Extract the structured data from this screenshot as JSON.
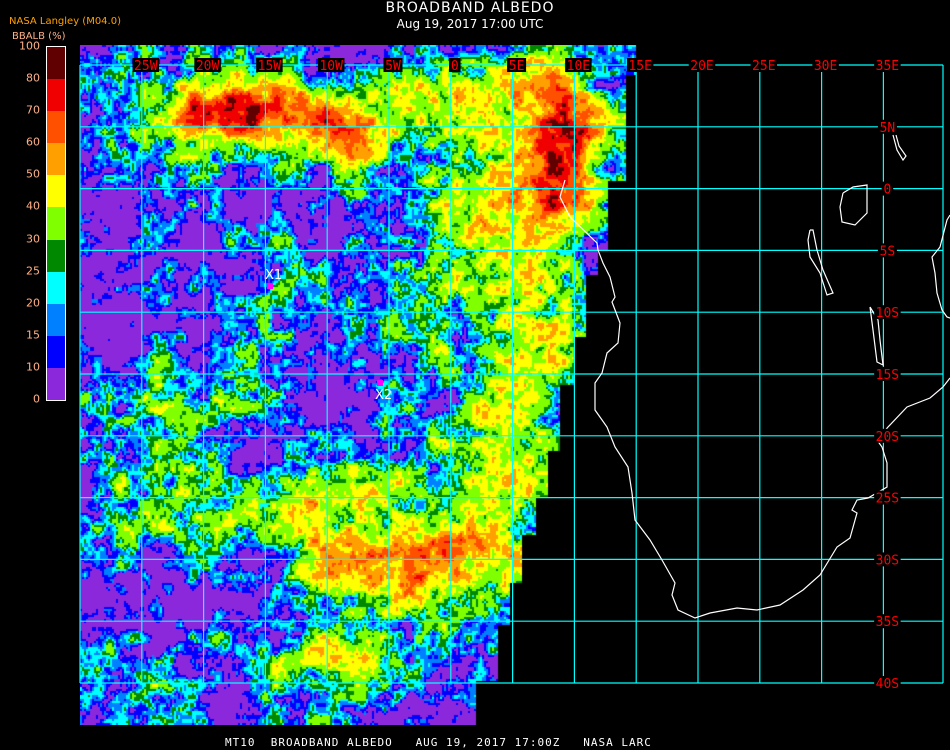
{
  "header": {
    "title": "BROADBAND ALBEDO",
    "subtitle": "Aug 19, 2017 17:00 UTC",
    "source": "NASA Langley (M04.0)",
    "units_label": "BBALB (%)"
  },
  "colorbar": {
    "ticks": [
      "0",
      "10",
      "15",
      "20",
      "25",
      "30",
      "40",
      "50",
      "60",
      "70",
      "80",
      "100"
    ],
    "bins": [
      {
        "min": 0,
        "max": 10,
        "color": "#8c28dc"
      },
      {
        "min": 10,
        "max": 15,
        "color": "#0000ff"
      },
      {
        "min": 15,
        "max": 20,
        "color": "#0080ff"
      },
      {
        "min": 20,
        "max": 25,
        "color": "#00ffff"
      },
      {
        "min": 25,
        "max": 30,
        "color": "#008800"
      },
      {
        "min": 30,
        "max": 40,
        "color": "#80ff00"
      },
      {
        "min": 40,
        "max": 50,
        "color": "#ffff00"
      },
      {
        "min": 50,
        "max": 60,
        "color": "#ffa000"
      },
      {
        "min": 60,
        "max": 70,
        "color": "#ff5000"
      },
      {
        "min": 70,
        "max": 80,
        "color": "#f00000"
      },
      {
        "min": 80,
        "max": 100,
        "color": "#600000"
      }
    ]
  },
  "map": {
    "lon_labels": [
      "25W",
      "20W",
      "15W",
      "10W",
      "5W",
      "0",
      "5E",
      "10E",
      "15E",
      "20E",
      "25E",
      "30E",
      "35E"
    ],
    "lat_labels": [
      "5N",
      "0",
      "5S",
      "10S",
      "15S",
      "20S",
      "25S",
      "30S",
      "35S",
      "40S"
    ],
    "grid_color": "#00ffff",
    "label_color": "#ff0000",
    "coast_color": "#ffffff",
    "markers": [
      {
        "label": "X1",
        "color": "#ff00ff"
      },
      {
        "label": "X2",
        "color": "#ff00ff"
      }
    ]
  },
  "footer": {
    "caption": "MT10  BROADBAND ALBEDO   AUG 19, 2017 17:00Z   NASA LARC"
  }
}
